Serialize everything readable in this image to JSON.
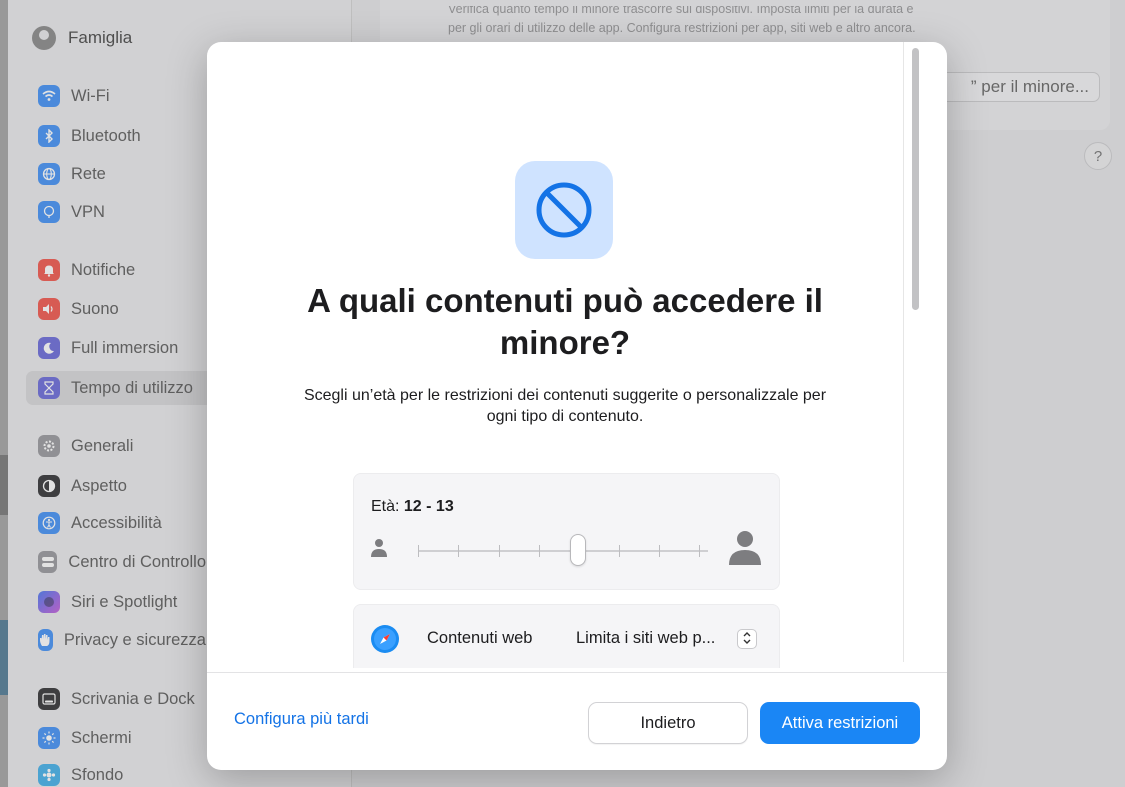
{
  "sidebar": {
    "family_label": "Famiglia",
    "items": [
      {
        "label": "Wi-Fi",
        "icon": "wifi-icon",
        "color": "#2f86f5"
      },
      {
        "label": "Bluetooth",
        "icon": "bluetooth-icon",
        "color": "#2f86f5"
      },
      {
        "label": "Rete",
        "icon": "globe-icon",
        "color": "#2f86f5"
      },
      {
        "label": "VPN",
        "icon": "vpn-icon",
        "color": "#2f86f5"
      },
      {
        "label": "Notifiche",
        "icon": "bell-icon",
        "color": "#f0453a"
      },
      {
        "label": "Suono",
        "icon": "speaker-icon",
        "color": "#f0453a"
      },
      {
        "label": "Full immersion",
        "icon": "moon-icon",
        "color": "#5b5bd6"
      },
      {
        "label": "Tempo di utilizzo",
        "icon": "hourglass-icon",
        "color": "#5b5bd6"
      },
      {
        "label": "Generali",
        "icon": "gear-icon",
        "color": "#8e8e93"
      },
      {
        "label": "Aspetto",
        "icon": "appearance-icon",
        "color": "#1d1d1f"
      },
      {
        "label": "Accessibilità",
        "icon": "accessibility-icon",
        "color": "#2f86f5"
      },
      {
        "label": "Centro di Controllo",
        "icon": "control-center-icon",
        "color": "#8e8e93"
      },
      {
        "label": "Siri e Spotlight",
        "icon": "siri-icon",
        "color": "#7a4fd6"
      },
      {
        "label": "Privacy e sicurezza",
        "icon": "hand-icon",
        "color": "#2f86f5"
      },
      {
        "label": "Scrivania e Dock",
        "icon": "dock-icon",
        "color": "#1d1d1f"
      },
      {
        "label": "Schermi",
        "icon": "sun-icon",
        "color": "#2f86f5"
      },
      {
        "label": "Sfondo",
        "icon": "wallpaper-icon",
        "color": "#2fa8e8"
      }
    ]
  },
  "main": {
    "description_line1": "Verifica quanto tempo il minore trascorre sui dispositivi. Imposta limiti per la durata e",
    "description_line2": "per gli orari di utilizzo delle app. Configura restrizioni per app, siti web e altro ancora.",
    "setup_button_label": "” per il minore...",
    "help_label": "?"
  },
  "sheet": {
    "title": "A quali contenuti può accedere il minore?",
    "subtitle": "Scegli un’età per le restrizioni dei contenuti suggerite o personalizzale per ogni tipo di contenuto.",
    "age_prefix": "Età: ",
    "age_value": "12 - 13",
    "slider_level": 0.55,
    "web_content_label": "Contenuti web",
    "web_content_value": "Limita i siti web p...",
    "later_label": "Configura più tardi",
    "back_label": "Indietro",
    "enable_label": "Attiva restrizioni",
    "accent_color": "#1a86f5"
  }
}
